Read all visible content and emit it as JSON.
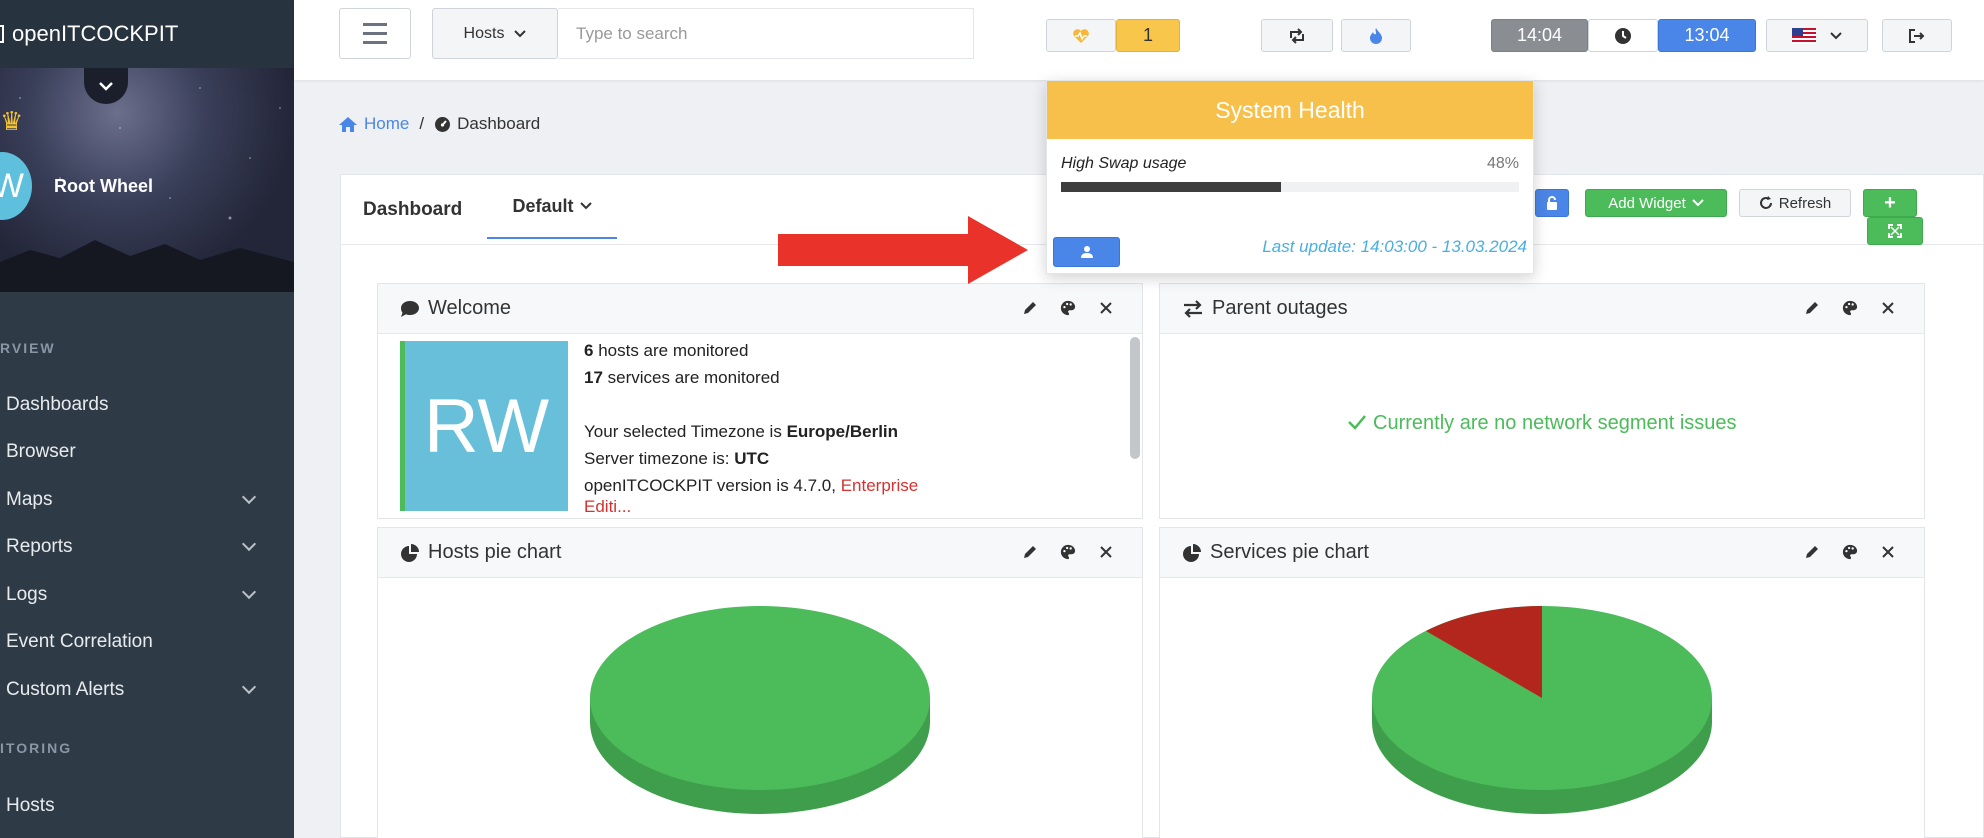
{
  "app": {
    "name": "openITCOCKPIT"
  },
  "user": {
    "initials": "W",
    "name": "Root Wheel",
    "avatar_initials": "RW"
  },
  "sidebar": {
    "section_overview": "RVIEW",
    "section_monitoring": "ITORING",
    "items": [
      {
        "label": "Dashboards",
        "expandable": false
      },
      {
        "label": "Browser",
        "expandable": false
      },
      {
        "label": "Maps",
        "expandable": true
      },
      {
        "label": "Reports",
        "expandable": true
      },
      {
        "label": "Logs",
        "expandable": true
      },
      {
        "label": "Event Correlation",
        "expandable": false
      },
      {
        "label": "Custom Alerts",
        "expandable": true
      },
      {
        "label": "Hosts",
        "expandable": false
      }
    ]
  },
  "topbar": {
    "search_scope": "Hosts",
    "search_placeholder": "Type to search",
    "health_count": "1",
    "time_local": "14:04",
    "time_server": "13:04"
  },
  "breadcrumb": {
    "home": "Home",
    "separator": "/",
    "current": "Dashboard"
  },
  "dashboard": {
    "title": "Dashboard",
    "tab": "Default",
    "add_widget": "Add Widget",
    "refresh": "Refresh"
  },
  "widgets": {
    "welcome": {
      "title": "Welcome",
      "hosts_count": "6",
      "hosts_text": "hosts are monitored",
      "services_count": "17",
      "services_text": "services are monitored",
      "tz_text": "Your selected Timezone is",
      "tz_value": "Europe/Berlin",
      "server_tz_text": "Server timezone is:",
      "server_tz_value": "UTC",
      "version_text": "openITCOCKPIT version is 4.7.0,",
      "edition": "Enterprise",
      "edition_cut": "Editi..."
    },
    "parent_outages": {
      "title": "Parent outages",
      "message": "Currently are no network segment issues"
    },
    "hosts_pie": {
      "title": "Hosts pie chart"
    },
    "services_pie": {
      "title": "Services pie chart"
    }
  },
  "system_health": {
    "title": "System Health",
    "metric_label": "High Swap usage",
    "metric_value": "48%",
    "metric_fraction": 0.48,
    "last_update": "Last update: 14:03:00 - 13.03.2024"
  },
  "colors": {
    "ok": "#4cbb5a",
    "critical": "#b3261e",
    "warning": "#f7c04a",
    "primary": "#4a86e8"
  }
}
